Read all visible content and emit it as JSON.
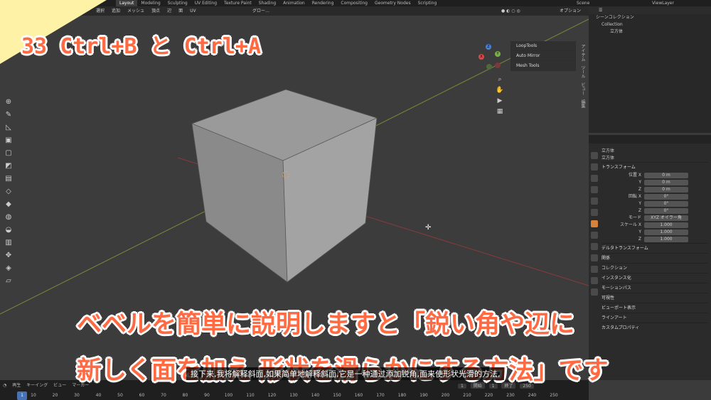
{
  "topbar": {
    "tabs": [
      "Layout",
      "Modeling",
      "Sculpting",
      "UV Editing",
      "Texture Paint",
      "Shading",
      "Animation",
      "Rendering",
      "Compositing",
      "Geometry Nodes",
      "Scripting"
    ],
    "scene": "Scene",
    "view_layer": "ViewLayer"
  },
  "header": {
    "menus": [
      "選択",
      "追加",
      "メッシュ",
      "頂点",
      "辺",
      "面",
      "UV"
    ],
    "transform_orientation": "グロー…",
    "options": "オプション"
  },
  "viewport": {
    "npanel": [
      "LoopTools",
      "Auto Mirror",
      "Mesh Tools"
    ],
    "gizmo": {
      "x": "X",
      "y": "Y",
      "z": "Z"
    },
    "side_tabs": [
      "アイテム",
      "ツール",
      "ビュー",
      "編集"
    ]
  },
  "outliner": {
    "title": "シーンコレクション",
    "collection": "Collection",
    "object": "立方体"
  },
  "properties": {
    "object_name": "立方体",
    "data_name": "立方体",
    "transform_header": "トランスフォーム",
    "location_label": "位置 X",
    "rotation_label": "回転 X",
    "scale_label": "スケール X",
    "y_label": "Y",
    "z_label": "Z",
    "loc": [
      "0 m",
      "0 m",
      "0 m"
    ],
    "rot": [
      "0°",
      "0°",
      "0°"
    ],
    "mode_label": "モード",
    "mode_value": "XYZ オイラー角",
    "scale": [
      "1.000",
      "1.000",
      "1.000"
    ],
    "delta": "デルタトランスフォーム",
    "sections": [
      "関係",
      "コレクション",
      "インスタンス化",
      "モーションパス",
      "可視性",
      "ビューポート表示",
      "ラインアート",
      "カスタムプロパティ"
    ]
  },
  "timeline": {
    "menus": [
      "再生",
      "キーイング",
      "ビュー",
      "マーカー"
    ],
    "frames": [
      "1",
      "10",
      "20",
      "30",
      "40",
      "50",
      "60",
      "70",
      "80",
      "90",
      "100",
      "110",
      "120",
      "130",
      "140",
      "150",
      "160",
      "170",
      "180",
      "190",
      "200",
      "210",
      "220",
      "230",
      "240",
      "250"
    ],
    "current": "1",
    "start_label": "開始",
    "start": "1",
    "end_label": "終了",
    "end": "250"
  },
  "overlay": {
    "title": "33 Ctrl+B と Ctrl+A",
    "line1": "ベベルを簡単に説明しますと「鋭い角や辺に",
    "line2": "新しく面を加え 形状を滑らかにする方法」です",
    "caption": "接下来,我将解释斜面,如果简单地解释斜面,它是一种通过添加锐角,面来使形状光滑的方法,"
  },
  "colors": {
    "accent": "#ff6a43",
    "corner": "#fdf2a5",
    "active_frame": "#4772b3"
  }
}
